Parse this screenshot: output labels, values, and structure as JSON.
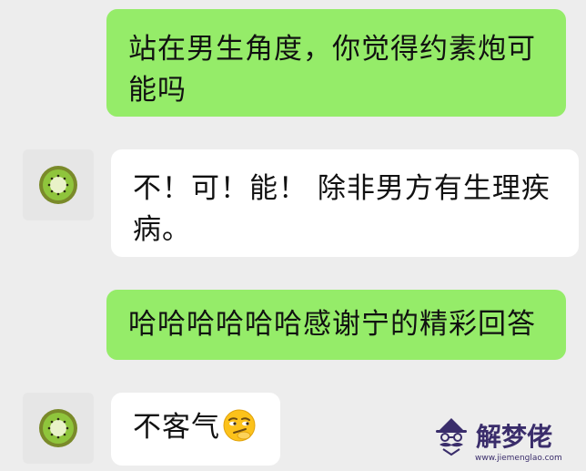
{
  "messages": [
    {
      "side": "me",
      "text": "站在男生角度，你觉得约素炮可能吗"
    },
    {
      "side": "them",
      "avatar": "kiwi-avatar",
      "text": "不！可！能！ 除非男方有生理疾病。"
    },
    {
      "side": "me",
      "text": "哈哈哈哈哈哈感谢宁的精彩回答"
    },
    {
      "side": "them",
      "avatar": "kiwi-avatar",
      "text": "不客气",
      "emoji": "smirk-face-emoji"
    }
  ],
  "watermark": {
    "title": "解梦佬",
    "url": "www.jiemenglao.com",
    "logo": "mustache-man-logo"
  },
  "colors": {
    "background": "#ededed",
    "my_bubble": "#95ec69",
    "their_bubble": "#ffffff",
    "watermark": "#3a2d6b"
  }
}
